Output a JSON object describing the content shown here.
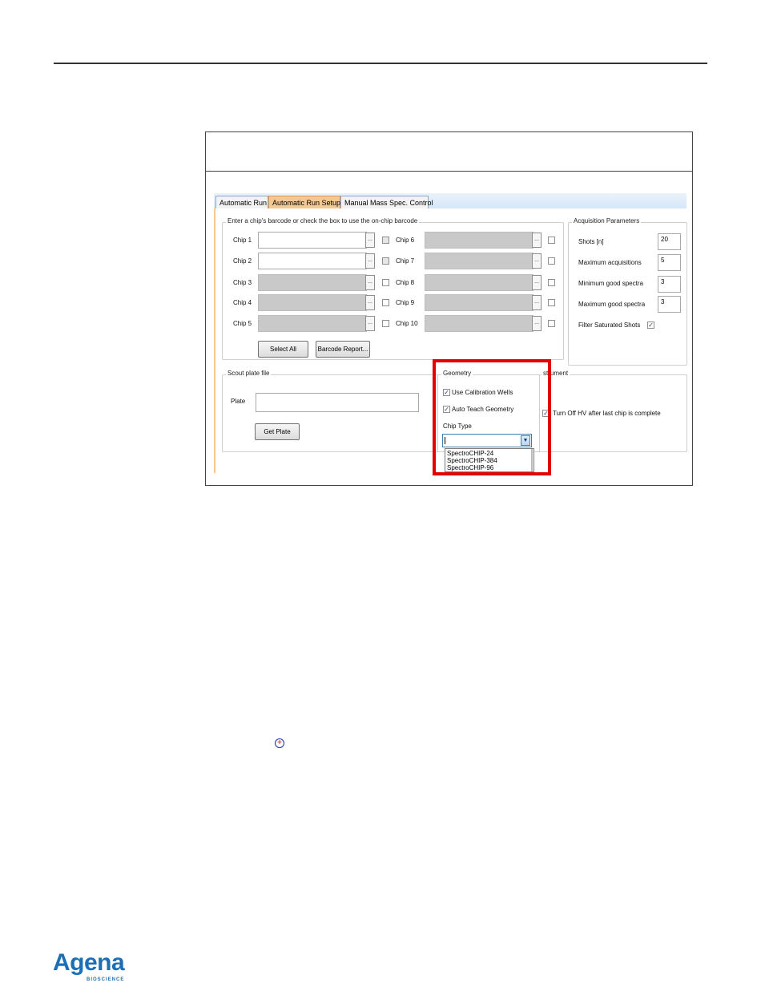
{
  "tabs": [
    {
      "label": "Automatic Run",
      "active": false
    },
    {
      "label": "Automatic Run Setup",
      "active": true
    },
    {
      "label": "Manual Mass Spec. Control",
      "active": false
    }
  ],
  "barcode_group": {
    "title": "Enter a chip's barcode or check the box to use the on-chip barcode",
    "browse_label": "...",
    "chips_left": [
      {
        "label": "Chip 1",
        "enabled": true
      },
      {
        "label": "Chip 2",
        "enabled": true
      },
      {
        "label": "Chip 3",
        "enabled": false
      },
      {
        "label": "Chip 4",
        "enabled": false
      },
      {
        "label": "Chip 5",
        "enabled": false
      }
    ],
    "chips_right": [
      {
        "label": "Chip 6",
        "enabled": false
      },
      {
        "label": "Chip 7",
        "enabled": false
      },
      {
        "label": "Chip 8",
        "enabled": false
      },
      {
        "label": "Chip 9",
        "enabled": false
      },
      {
        "label": "Chip 10",
        "enabled": false
      }
    ],
    "select_all_label": "Select All",
    "barcode_report_label": "Barcode Report..."
  },
  "acquisition": {
    "title": "Acquisition Parameters",
    "shots_label": "Shots [n]",
    "shots_value": "20",
    "max_acq_label": "Maximum acquisitions",
    "max_acq_value": "5",
    "min_good_label": "Minimum good spectra",
    "min_good_value": "3",
    "max_good_label": "Maximum good spectra",
    "max_good_value": "3",
    "filter_label": "Filter Saturated Shots",
    "filter_checked": true
  },
  "scout": {
    "title": "Scout plate file",
    "plate_label": "Plate",
    "plate_value": "",
    "get_plate_label": "Get Plate"
  },
  "geometry": {
    "title": "Geometry",
    "use_calibration_label": "Use Calibration Wells",
    "use_calibration_checked": true,
    "auto_teach_label": "Auto Teach Geometry",
    "auto_teach_checked": true,
    "chip_type_label": "Chip Type",
    "chip_type_value": "",
    "chip_type_options": [
      "SpectroCHIP-24",
      "SpectroCHIP-384",
      "SpectroCHIP-96"
    ]
  },
  "instrument": {
    "title_partial": "strument",
    "turn_off_hv_label": "Turn Off HV after last chip is complete",
    "turn_off_hv_checked": true
  },
  "check_mark": "✓",
  "icons": {
    "add_icon": "add-circle-icon",
    "dropdown_icon": "chevron-down-icon"
  },
  "logo": {
    "word": "Agena",
    "sub": "BIOSCIENCE"
  },
  "colors": {
    "highlight": "#e50000",
    "active_tab": "#f6c791",
    "logo_blue": "#1c6fb6"
  }
}
